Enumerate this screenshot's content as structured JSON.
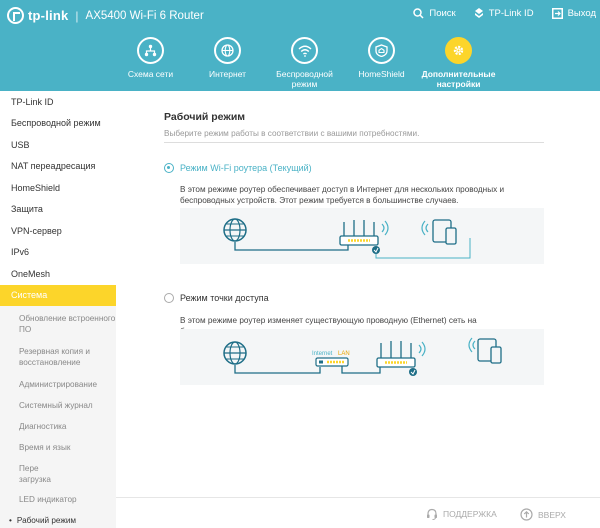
{
  "brand": "tp-link",
  "model": "AX5400 Wi-Fi 6 Router",
  "top_actions": {
    "search": "Поиск",
    "tplink_id": "TP-Link ID",
    "logout": "Выход"
  },
  "nav": [
    {
      "label": "Схема сети",
      "icon": "network-map-icon"
    },
    {
      "label": "Интернет",
      "icon": "globe-icon"
    },
    {
      "label": "Беспроводной режим",
      "icon": "wifi-icon"
    },
    {
      "label": "HomeShield",
      "icon": "shield-home-icon"
    },
    {
      "label": "Дополнительные настройки",
      "icon": "gear-icon",
      "active": true
    }
  ],
  "sidebar": {
    "items": [
      "TP-Link ID",
      "Беспроводной режим",
      "USB",
      "NAT переадресация",
      "HomeShield",
      "Защита",
      "VPN-сервер",
      "IPv6",
      "OneMesh",
      "Система"
    ],
    "active": "Система",
    "sub_items": [
      "Обновление встроенного ПО",
      "Резервная копия и восстановление",
      "Администрирование",
      "Системный журнал",
      "Диагностика",
      "Время и язык",
      "Пере загрузка",
      "LED индикатор",
      "Рабочий режим"
    ],
    "current_sub": "Рабочий режим"
  },
  "main": {
    "title": "Рабочий режим",
    "description": "Выберите режим работы в соответствии с вашими потребностями.",
    "modes": [
      {
        "label": "Режим Wi-Fi роутера (Текущий)",
        "selected": true,
        "description": "В этом режиме роутер обеспечивает доступ в Интернет для нескольких проводных и беспроводных устройств. Этот режим требуется в большинстве случаев."
      },
      {
        "label": "Режим точки доступа",
        "selected": false,
        "description": "В этом режиме роутер изменяет существующую проводную (Ethernet) сеть на беспроводную.",
        "diagram_labels": {
          "internet": "Internet",
          "lan": "LAN"
        }
      }
    ]
  },
  "footer": {
    "support": "ПОДДЕРЖКА",
    "top": "ВВЕРХ"
  },
  "colors": {
    "header": "#4ab2c6",
    "accent": "#fcd52a",
    "link": "#4ab2c6"
  }
}
